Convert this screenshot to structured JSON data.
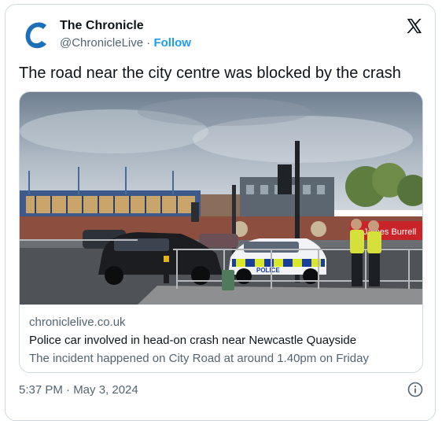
{
  "colors": {
    "brand_blue": "#1d6fb8",
    "link": "#1d9bf0",
    "text_primary": "#0f1419",
    "text_secondary": "#536471",
    "border": "#cfd9de"
  },
  "author": {
    "name": "The Chronicle",
    "handle": "@ChronicleLive",
    "separator": "·",
    "follow_label": "Follow",
    "logo_icon": "chronicle-c-logo"
  },
  "tweet": {
    "text": "The road near the city centre was blocked by the crash",
    "timestamp": "5:37 PM · May 3, 2024"
  },
  "link_card": {
    "domain": "chroniclelive.co.uk",
    "title": "Police car involved in head-on crash near Newcastle Quayside",
    "description": "The incident happened on City Road at around 1.40pm on Friday",
    "image_sign_text": "James Burrell",
    "image_police_text": "POLICE"
  },
  "icons": {
    "platform": "x-logo-icon",
    "info": "info-icon"
  }
}
